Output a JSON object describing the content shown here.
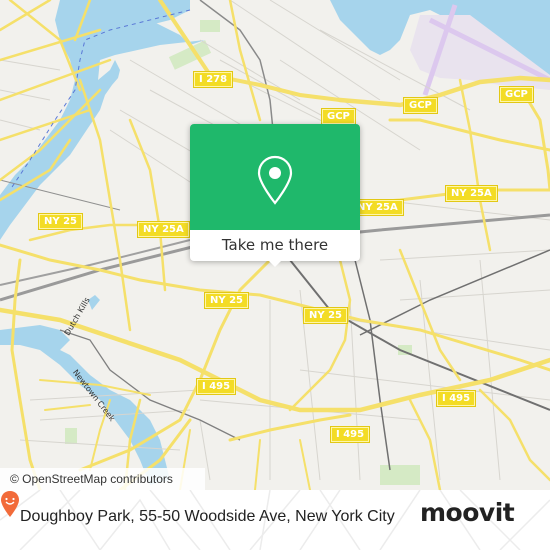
{
  "map": {
    "colors": {
      "background": "#f2f1ed",
      "water": "#a6d4ec",
      "road_major": "#f5e06a",
      "road_minor": "#d7d5cf",
      "rail": "#7a7a7a",
      "park": "#d5eac5",
      "airport": "#e6dcf0"
    },
    "route_shields": [
      {
        "label": "I 278"
      },
      {
        "label": "GCP"
      },
      {
        "label": "GCP"
      },
      {
        "label": "GCP"
      },
      {
        "label": "NY 25A"
      },
      {
        "label": "NY 25A"
      },
      {
        "label": "NY 25A"
      },
      {
        "label": "NY 25"
      },
      {
        "label": "NY 25"
      },
      {
        "label": "NY 25"
      },
      {
        "label": "I 495"
      },
      {
        "label": "I 495"
      },
      {
        "label": "I 495"
      }
    ],
    "water_labels": [
      {
        "label": "Dutch Kills"
      },
      {
        "label": "Newtown Creek"
      }
    ],
    "attribution": "© OpenStreetMap contributors"
  },
  "popup": {
    "icon": "location-pin-icon",
    "button_label": "Take me there",
    "accent": "#1fb86b"
  },
  "footer": {
    "address": "Doughboy Park, 55-50 Woodside Ave, New York City",
    "brand": "moovit",
    "brand_color": "#f26b3a"
  }
}
